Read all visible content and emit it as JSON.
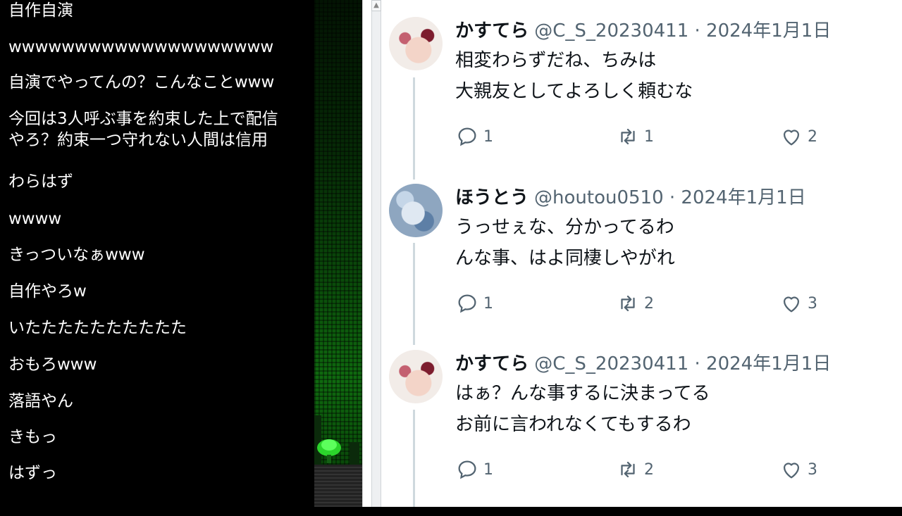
{
  "chat": {
    "lines": [
      "自作自演",
      "wwwwwwwwwwwwwwwwwwww",
      "自演でやってんの？こんなことwww",
      [
        "今回は3人呼ぶ事を約束した上で配信",
        "やろ？約束一つ守れない人間は信用"
      ],
      "わらはず",
      "wwww",
      "きっついなぁwww",
      "自作やろw",
      "いたたたたたたたたたた",
      "おもろwww",
      "落語やん",
      "きもっ",
      "はずっ"
    ]
  },
  "tweets": [
    {
      "name": "かすてら",
      "handle": "@C_S_20230411",
      "date": "· 2024年1月1日",
      "text": [
        "相変わらずだね、ちみは",
        "大親友としてよろしく頼むな"
      ],
      "replies": "1",
      "retweets": "1",
      "likes": "2"
    },
    {
      "name": "ほうとう",
      "handle": "@houtou0510",
      "date": "· 2024年1月1日",
      "text": [
        "うっせぇな、分かってるわ",
        "んな事、はよ同棲しやがれ"
      ],
      "replies": "1",
      "retweets": "2",
      "likes": "3"
    },
    {
      "name": "かすてら",
      "handle": "@C_S_20230411",
      "date": "· 2024年1月1日",
      "text": [
        "はぁ？んな事するに決まってる",
        "お前に言われなくてもするわ"
      ],
      "replies": "1",
      "retweets": "2",
      "likes": "3"
    }
  ],
  "icons": {
    "reply": "speech-bubble-icon",
    "retweet": "retweet-icon",
    "like": "heart-icon"
  },
  "colors": {
    "text_primary": "#0f1419",
    "text_secondary": "#536471",
    "thread_line": "#cfd9de"
  }
}
